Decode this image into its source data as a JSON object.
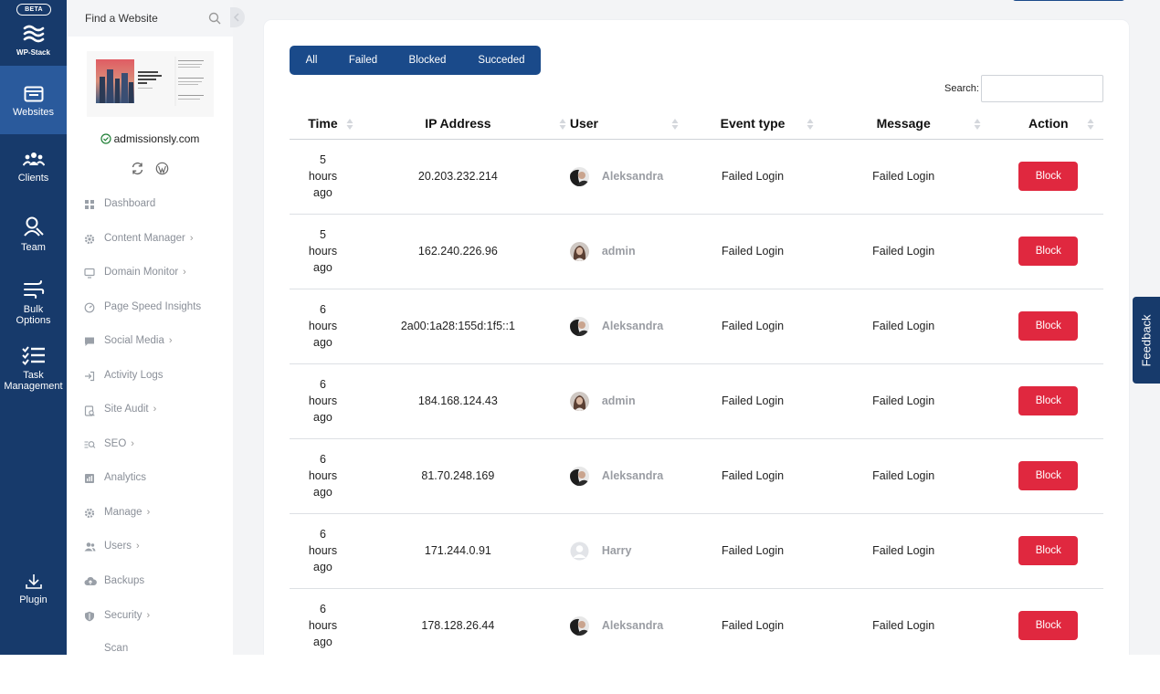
{
  "rail": {
    "beta": "BETA",
    "logo_text": "WP-Stack",
    "items": [
      {
        "label": "Websites",
        "icon": "browser-window-icon"
      },
      {
        "label": "Clients",
        "icon": "clients-group-icon"
      },
      {
        "label": "Team",
        "icon": "team-user-icon"
      },
      {
        "label": "Bulk Options",
        "icon": "wind-lines-icon"
      },
      {
        "label": "Task Management",
        "icon": "checklist-icon"
      },
      {
        "label": "Plugin",
        "icon": "download-icon"
      }
    ]
  },
  "panel": {
    "find_label": "Find a Website",
    "site_name": "admissionsly.com",
    "menu": [
      {
        "label": "Dashboard",
        "icon": "dashboard-icon",
        "chevron": false
      },
      {
        "label": "Content Manager",
        "icon": "gear-icon",
        "chevron": true
      },
      {
        "label": "Domain Monitor",
        "icon": "monitor-icon",
        "chevron": true
      },
      {
        "label": "Page Speed Insights",
        "icon": "speedometer-icon",
        "chevron": false
      },
      {
        "label": "Social Media",
        "icon": "chat-icon",
        "chevron": true
      },
      {
        "label": "Activity Logs",
        "icon": "login-arrow-icon",
        "chevron": false
      },
      {
        "label": "Site Audit",
        "icon": "audit-clipboard-icon",
        "chevron": true
      },
      {
        "label": "SEO",
        "icon": "seo-search-icon",
        "chevron": true
      },
      {
        "label": "Analytics",
        "icon": "analytics-icon",
        "chevron": false
      },
      {
        "label": "Manage",
        "icon": "gear-icon",
        "chevron": true
      },
      {
        "label": "Users",
        "icon": "users-icon",
        "chevron": true
      },
      {
        "label": "Backups",
        "icon": "cloud-upload-icon",
        "chevron": false
      },
      {
        "label": "Security",
        "icon": "shield-icon",
        "chevron": true
      },
      {
        "label": "Scan",
        "icon": "",
        "chevron": false
      }
    ]
  },
  "filters": [
    "All",
    "Failed",
    "Blocked",
    "Succeded"
  ],
  "search": {
    "label": "Search:",
    "value": ""
  },
  "table": {
    "headers": [
      "Time",
      "IP Address",
      "User",
      "Event type",
      "Message",
      "Action"
    ],
    "rows": [
      {
        "time": [
          "5",
          "hours",
          "ago"
        ],
        "ip": "20.203.232.214",
        "user": "Aleksandra",
        "event": "Failed Login",
        "message": "Failed Login",
        "action": "Block"
      },
      {
        "time": [
          "5",
          "hours",
          "ago"
        ],
        "ip": "162.240.226.96",
        "user": "admin",
        "event": "Failed Login",
        "message": "Failed Login",
        "action": "Block"
      },
      {
        "time": [
          "6",
          "hours",
          "ago"
        ],
        "ip": "2a00:1a28:155d:1f5::1",
        "user": "Aleksandra",
        "event": "Failed Login",
        "message": "Failed Login",
        "action": "Block"
      },
      {
        "time": [
          "6",
          "hours",
          "ago"
        ],
        "ip": "184.168.124.43",
        "user": "admin",
        "event": "Failed Login",
        "message": "Failed Login",
        "action": "Block"
      },
      {
        "time": [
          "6",
          "hours",
          "ago"
        ],
        "ip": "81.70.248.169",
        "user": "Aleksandra",
        "event": "Failed Login",
        "message": "Failed Login",
        "action": "Block"
      },
      {
        "time": [
          "6",
          "hours",
          "ago"
        ],
        "ip": "171.244.0.91",
        "user": "Harry",
        "event": "Failed Login",
        "message": "Failed Login",
        "action": "Block"
      },
      {
        "time": [
          "6",
          "hours",
          "ago"
        ],
        "ip": "178.128.26.44",
        "user": "Aleksandra",
        "event": "Failed Login",
        "message": "Failed Login",
        "action": "Block"
      }
    ]
  },
  "feedback_label": "Feedback",
  "colors": {
    "rail": "#173a6b",
    "accent": "#1a4a8a",
    "block": "#e0283f",
    "active_rail": "#2a5a9c"
  }
}
